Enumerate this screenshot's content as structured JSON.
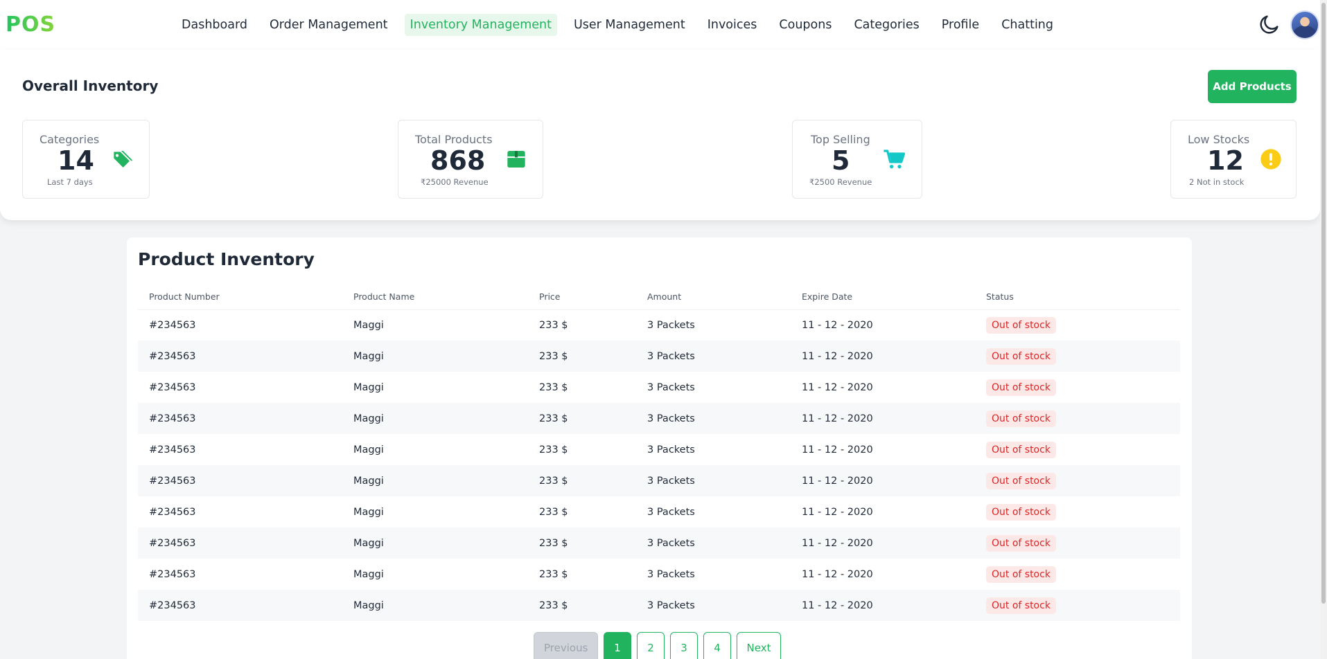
{
  "app": {
    "logo": "POS"
  },
  "nav": {
    "items": [
      {
        "label": "Dashboard"
      },
      {
        "label": "Order Management"
      },
      {
        "label": "Inventory Management",
        "active": true
      },
      {
        "label": "User Management"
      },
      {
        "label": "Invoices"
      },
      {
        "label": "Coupons"
      },
      {
        "label": "Categories"
      },
      {
        "label": "Profile"
      },
      {
        "label": "Chatting"
      }
    ]
  },
  "overall": {
    "title": "Overall Inventory",
    "add_button": "Add Products",
    "stats": [
      {
        "label": "Categories",
        "value": "14",
        "sub": "Last 7 days",
        "icon": "tags-icon",
        "color": "#22b35e"
      },
      {
        "label": "Total Products",
        "value": "868",
        "sub": "₹25000 Revenue",
        "icon": "box-icon",
        "color": "#22b35e"
      },
      {
        "label": "Top Selling",
        "value": "5",
        "sub": "₹2500 Revenue",
        "icon": "cart-icon",
        "color": "#14c8c8"
      },
      {
        "label": "Low Stocks",
        "value": "12",
        "sub": "2 Not in stock",
        "icon": "warning-icon",
        "color": "#facc15"
      }
    ]
  },
  "inventory": {
    "title": "Product Inventory",
    "columns": [
      "Product Number",
      "Product Name",
      "Price",
      "Amount",
      "Expire Date",
      "Status"
    ],
    "rows": [
      [
        "#234563",
        "Maggi",
        "233 $",
        "3 Packets",
        "11 - 12 - 2020",
        "Out of stock"
      ],
      [
        "#234563",
        "Maggi",
        "233 $",
        "3 Packets",
        "11 - 12 - 2020",
        "Out of stock"
      ],
      [
        "#234563",
        "Maggi",
        "233 $",
        "3 Packets",
        "11 - 12 - 2020",
        "Out of stock"
      ],
      [
        "#234563",
        "Maggi",
        "233 $",
        "3 Packets",
        "11 - 12 - 2020",
        "Out of stock"
      ],
      [
        "#234563",
        "Maggi",
        "233 $",
        "3 Packets",
        "11 - 12 - 2020",
        "Out of stock"
      ],
      [
        "#234563",
        "Maggi",
        "233 $",
        "3 Packets",
        "11 - 12 - 2020",
        "Out of stock"
      ],
      [
        "#234563",
        "Maggi",
        "233 $",
        "3 Packets",
        "11 - 12 - 2020",
        "Out of stock"
      ],
      [
        "#234563",
        "Maggi",
        "233 $",
        "3 Packets",
        "11 - 12 - 2020",
        "Out of stock"
      ],
      [
        "#234563",
        "Maggi",
        "233 $",
        "3 Packets",
        "11 - 12 - 2020",
        "Out of stock"
      ],
      [
        "#234563",
        "Maggi",
        "233 $",
        "3 Packets",
        "11 - 12 - 2020",
        "Out of stock"
      ]
    ]
  },
  "pagination": {
    "previous": "Previous",
    "pages": [
      "1",
      "2",
      "3",
      "4"
    ],
    "current": "1",
    "next": "Next"
  },
  "colors": {
    "accent": "#22b35e",
    "danger": "#dc2626"
  }
}
